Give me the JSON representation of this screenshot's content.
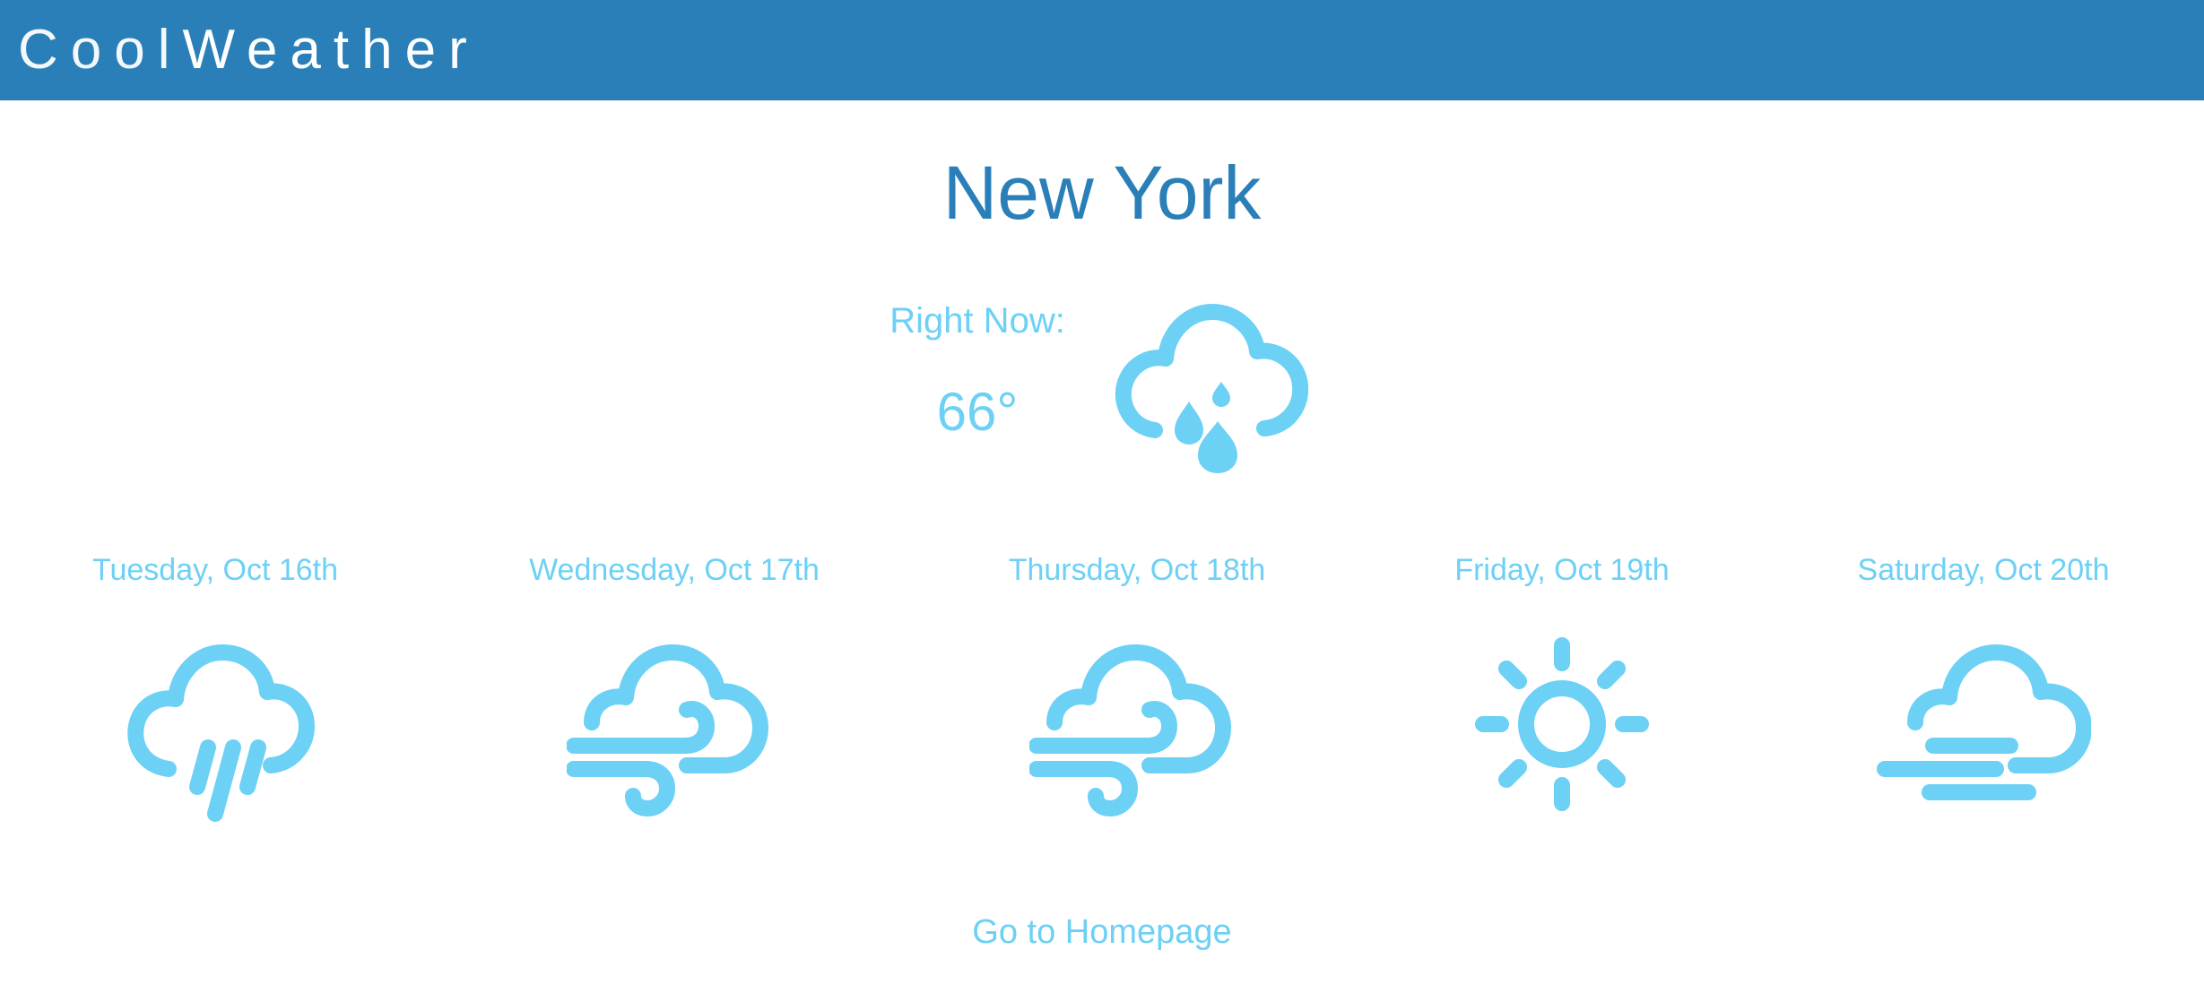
{
  "header": {
    "brand_light": "Cool",
    "brand_bold": "Weather",
    "bg_color": "#2a7fb8"
  },
  "city": "New York",
  "current": {
    "label": "Right Now:",
    "temperature": "66°",
    "icon": "cloud-rain-drops-icon"
  },
  "forecast": [
    {
      "label": "Tuesday, Oct 16th",
      "icon": "cloud-rain-icon"
    },
    {
      "label": "Wednesday, Oct 17th",
      "icon": "cloud-wind-icon"
    },
    {
      "label": "Thursday, Oct 18th",
      "icon": "cloud-wind-icon"
    },
    {
      "label": "Friday, Oct 19th",
      "icon": "sun-icon"
    },
    {
      "label": "Saturday, Oct 20th",
      "icon": "cloud-fog-icon"
    }
  ],
  "footer": {
    "home_link": "Go to Homepage"
  },
  "colors": {
    "accent": "#6dd0f5",
    "title": "#2a7fb8"
  }
}
